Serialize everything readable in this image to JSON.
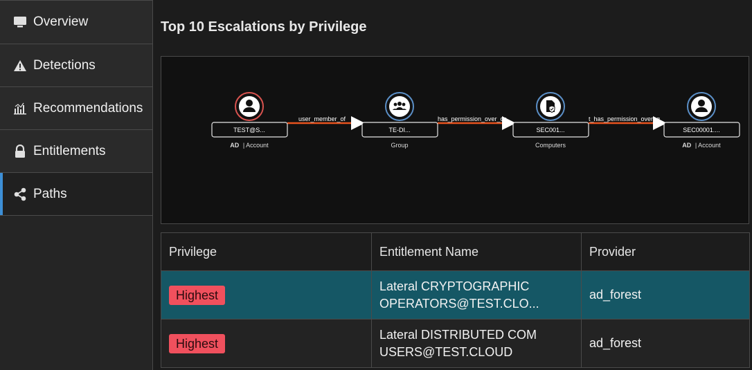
{
  "sidebar": {
    "items": [
      {
        "label": "Overview",
        "icon": "monitor-icon"
      },
      {
        "label": "Detections",
        "icon": "warning-icon"
      },
      {
        "label": "Recommendations",
        "icon": "bar-chart-icon"
      },
      {
        "label": "Entitlements",
        "icon": "lock-icon"
      },
      {
        "label": "Paths",
        "icon": "share-nodes-icon",
        "active": true
      }
    ]
  },
  "main": {
    "title": "Top 10 Escalations by Privilege"
  },
  "graph": {
    "nodes": [
      {
        "label": "TEST@S...",
        "type_bold": "AD",
        "type_rest": "| Account",
        "icon": "user-icon",
        "ring": "#d9534f"
      },
      {
        "label": "TE-DI...",
        "type_bold": "",
        "type_rest": "Group",
        "icon": "group-icon",
        "ring": "#5b8fc7"
      },
      {
        "label": "SEC001...",
        "type_bold": "",
        "type_rest": "Computers",
        "icon": "computer-shield-icon",
        "ring": "#5b8fc7"
      },
      {
        "label": "SEC00001....",
        "type_bold": "AD",
        "type_rest": "| Account",
        "icon": "user-icon",
        "ring": "#5b8fc7"
      }
    ],
    "edges": [
      {
        "label": "user_member_of"
      },
      {
        "label": "has_permission_over_co"
      },
      {
        "label": "t_has_permission_over_g"
      }
    ],
    "edge_color": "#e8531e"
  },
  "table": {
    "headers": [
      "Privilege",
      "Entitlement Name",
      "Provider"
    ],
    "rows": [
      {
        "privilege": "Highest",
        "name_line1": "Lateral CRYPTOGRAPHIC",
        "name_line2": "OPERATORS@TEST.CLO...",
        "provider": "ad_forest",
        "selected": true
      },
      {
        "privilege": "Highest",
        "name_line1": "Lateral DISTRIBUTED COM",
        "name_line2": "USERS@TEST.CLOUD",
        "provider": "ad_forest",
        "selected": false
      }
    ]
  }
}
